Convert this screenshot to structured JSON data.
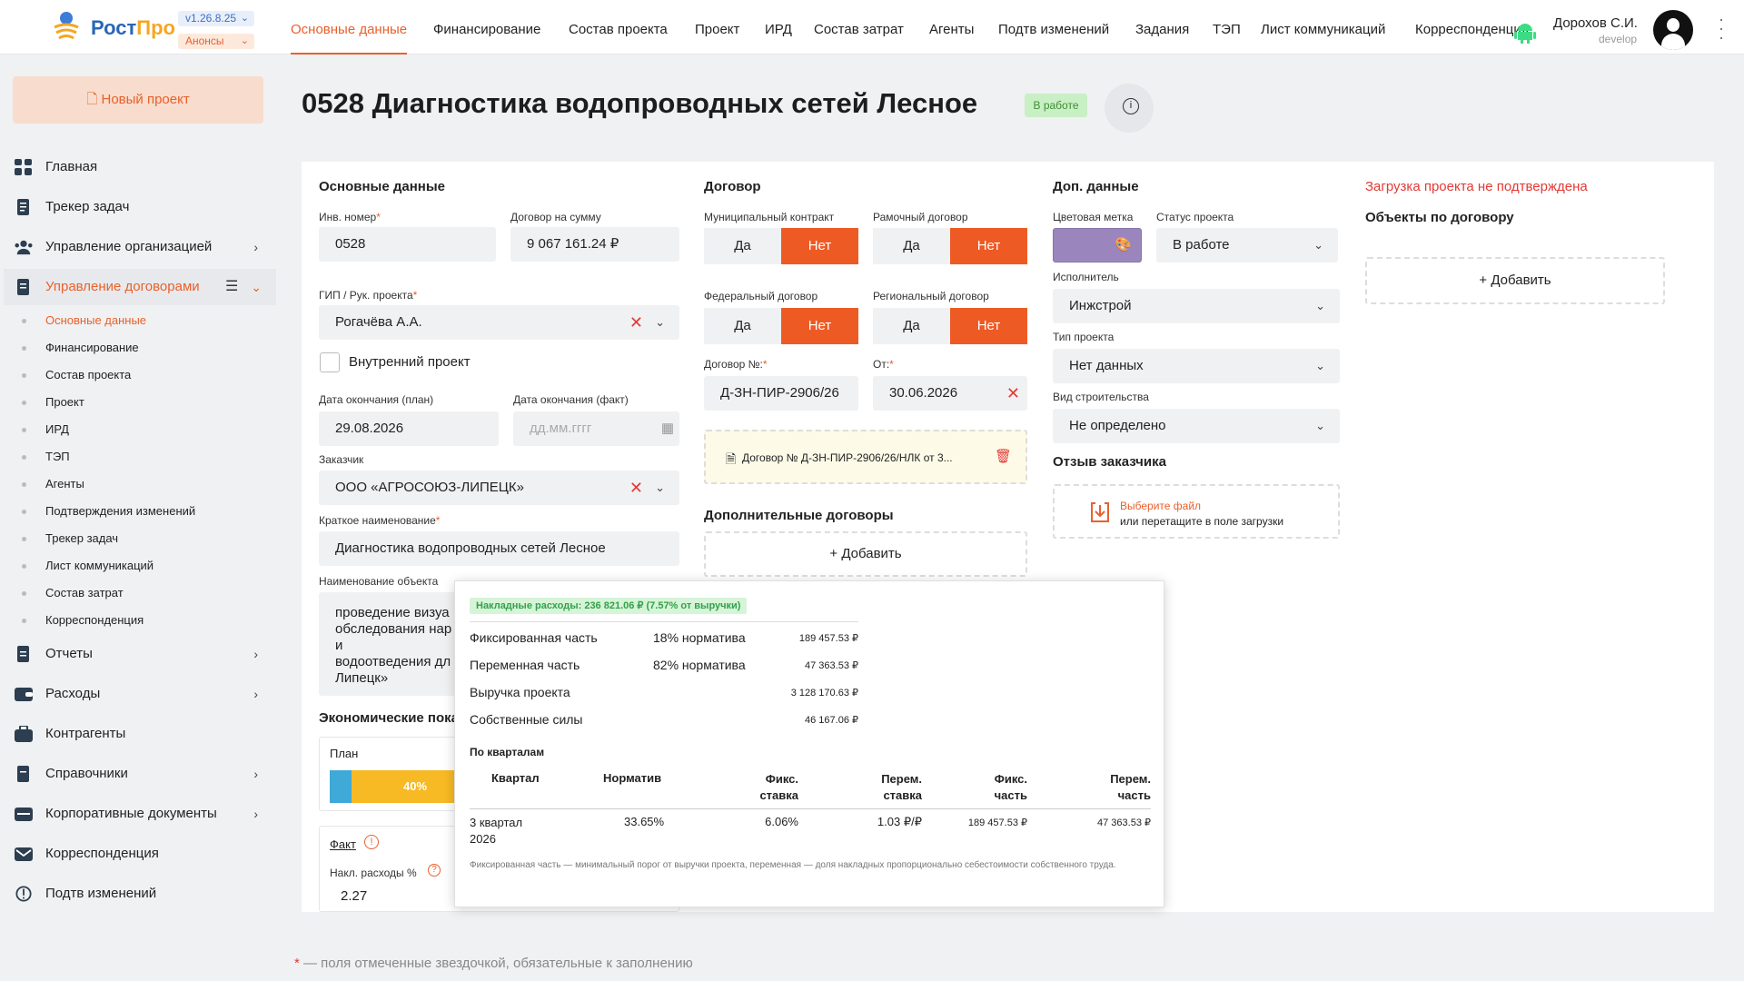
{
  "header": {
    "brand_a": "Рост",
    "brand_b": "Про",
    "version": "v1.26.8.25",
    "announces": "Анонсы",
    "tabs": [
      "Основные данные",
      "Финансирование",
      "Состав проекта",
      "Проект",
      "ИРД",
      "Состав затрат",
      "Агенты",
      "Подтв изменений",
      "Задания",
      "ТЭП",
      "Лист коммуникаций",
      "Корреспонденция"
    ],
    "active_tab": 0,
    "user_name": "Дорохов С.И.",
    "user_role": "develop"
  },
  "sidebar": {
    "new_project": "Новый проект",
    "items": [
      {
        "label": "Главная",
        "icon": "grid-icon",
        "chevron": false
      },
      {
        "label": "Трекер задач",
        "icon": "document-icon",
        "chevron": false
      },
      {
        "label": "Управление организацией",
        "icon": "users-icon",
        "chevron": true
      },
      {
        "label": "Управление договорами",
        "icon": "contract-icon",
        "chevron": true,
        "active": true
      },
      {
        "label": "Отчеты",
        "icon": "report-icon",
        "chevron": true
      },
      {
        "label": "Расходы",
        "icon": "wallet-icon",
        "chevron": true
      },
      {
        "label": "Контрагенты",
        "icon": "briefcase-icon",
        "chevron": false
      },
      {
        "label": "Справочники",
        "icon": "book-icon",
        "chevron": true
      },
      {
        "label": "Корпоративные документы",
        "icon": "folder-icon",
        "chevron": true
      },
      {
        "label": "Корреспонденция",
        "icon": "mail-icon",
        "chevron": false
      },
      {
        "label": "Подтв изменений",
        "icon": "alert-icon",
        "chevron": false
      }
    ],
    "subitems": [
      "Основные данные",
      "Финансирование",
      "Состав проекта",
      "Проект",
      "ИРД",
      "ТЭП",
      "Агенты",
      "Подтверждения изменений",
      "Трекер задач",
      "Лист коммуникаций",
      "Состав затрат",
      "Корреспонденция"
    ]
  },
  "page": {
    "title": "0528 Диагностика водопроводных сетей Лесное",
    "status_badge": "В работе"
  },
  "main_data": {
    "section": "Основные данные",
    "inv_label": "Инв. номер",
    "inv_value": "0528",
    "sum_label": "Договор на сумму",
    "sum_value": "9 067 161.24 ₽",
    "gip_label": "ГИП / Рук. проекта",
    "gip_value": "Рогачёва А.А.",
    "internal_label": "Внутренний проект",
    "end_plan_label": "Дата окончания (план)",
    "end_plan_value": "29.08.2026",
    "end_fact_label": "Дата окончания (факт)",
    "end_fact_placeholder": "дд.мм.гггг",
    "customer_label": "Заказчик",
    "customer_value": "ООО «АГРОСОЮЗ-ЛИПЕЦК»",
    "short_label": "Краткое наименование",
    "short_value": "Диагностика водопроводных сетей Лесное",
    "object_label": "Наименование объекта",
    "object_lines": [
      "проведение визуа",
      "обследования нар",
      "и",
      "водоотведения дл",
      "Липецк»"
    ],
    "econ_label": "Экономические пока",
    "plan_label": "План",
    "plan_percent": "40%",
    "fact_label": "Факт",
    "overhead_label": "Накл. расходы %",
    "overhead_value": "2.27"
  },
  "contract": {
    "section": "Договор",
    "municipal": "Муниципальный контракт",
    "framework": "Рамочный договор",
    "federal": "Федеральный договор",
    "regional": "Региональный договор",
    "yes": "Да",
    "no": "Нет",
    "number_label": "Договор №:",
    "number_value": "Д-ЗН-ПИР-2906/26",
    "from_label": "От:",
    "from_value": "30.06.2026",
    "file_name": "Договор № Д-ЗН-ПИР-2906/26/НЛК от 3...",
    "additional": "Дополнительные договоры",
    "add": "Добавить"
  },
  "extra": {
    "section": "Доп. данные",
    "color_label": "Цветовая метка",
    "status_label": "Статус проекта",
    "status_value": "В работе",
    "executor_label": "Исполнитель",
    "executor_value": "Инжстрой",
    "type_label": "Тип проекта",
    "type_value": "Нет данных",
    "build_label": "Вид строительства",
    "build_value": "Не определено",
    "feedback_label": "Отзыв заказчика",
    "upload_a": "Выберите файл",
    "upload_b": "или перетащите в поле загрузки"
  },
  "right": {
    "warning": "Загрузка проекта не подтверждена",
    "objects": "Объекты по договору",
    "add": "Добавить"
  },
  "tooltip": {
    "badge": "Накладные расходы: 236 821.06 ₽ (7.57% от выручки)",
    "rows": [
      {
        "name": "Фиксированная часть",
        "norm": "18% норматива",
        "value": "189 457.53 ₽"
      },
      {
        "name": "Переменная часть",
        "norm": "82% норматива",
        "value": "47 363.53 ₽"
      },
      {
        "name": "Выручка проекта",
        "norm": "",
        "value": "3 128 170.63 ₽"
      },
      {
        "name": "Собственные силы",
        "norm": "",
        "value": "46 167.06 ₽"
      }
    ],
    "quarters_title": "По кварталам",
    "cols": [
      "Квартал",
      "Норматив",
      "Фикс.\nставка",
      "Перем.\nставка",
      "Фикс.\nчасть",
      "Перем.\nчасть"
    ],
    "q_row": [
      "3 квартал\n2026",
      "33.65%",
      "6.06%",
      "1.03 ₽/₽",
      "189 457.53 ₽",
      "47 363.53 ₽"
    ],
    "note": "Фиксированная часть — минимальный порог от выручки проекта, переменная — доля накладных пропорционально себестоимости собственного труда."
  },
  "footer": {
    "star": "*",
    "text": " — поля отмеченные звездочкой, обязательные к заполнению"
  },
  "colors": {
    "accent": "#e8612c",
    "brand": "#2a66b8",
    "color_mark": "#9a86bd"
  }
}
